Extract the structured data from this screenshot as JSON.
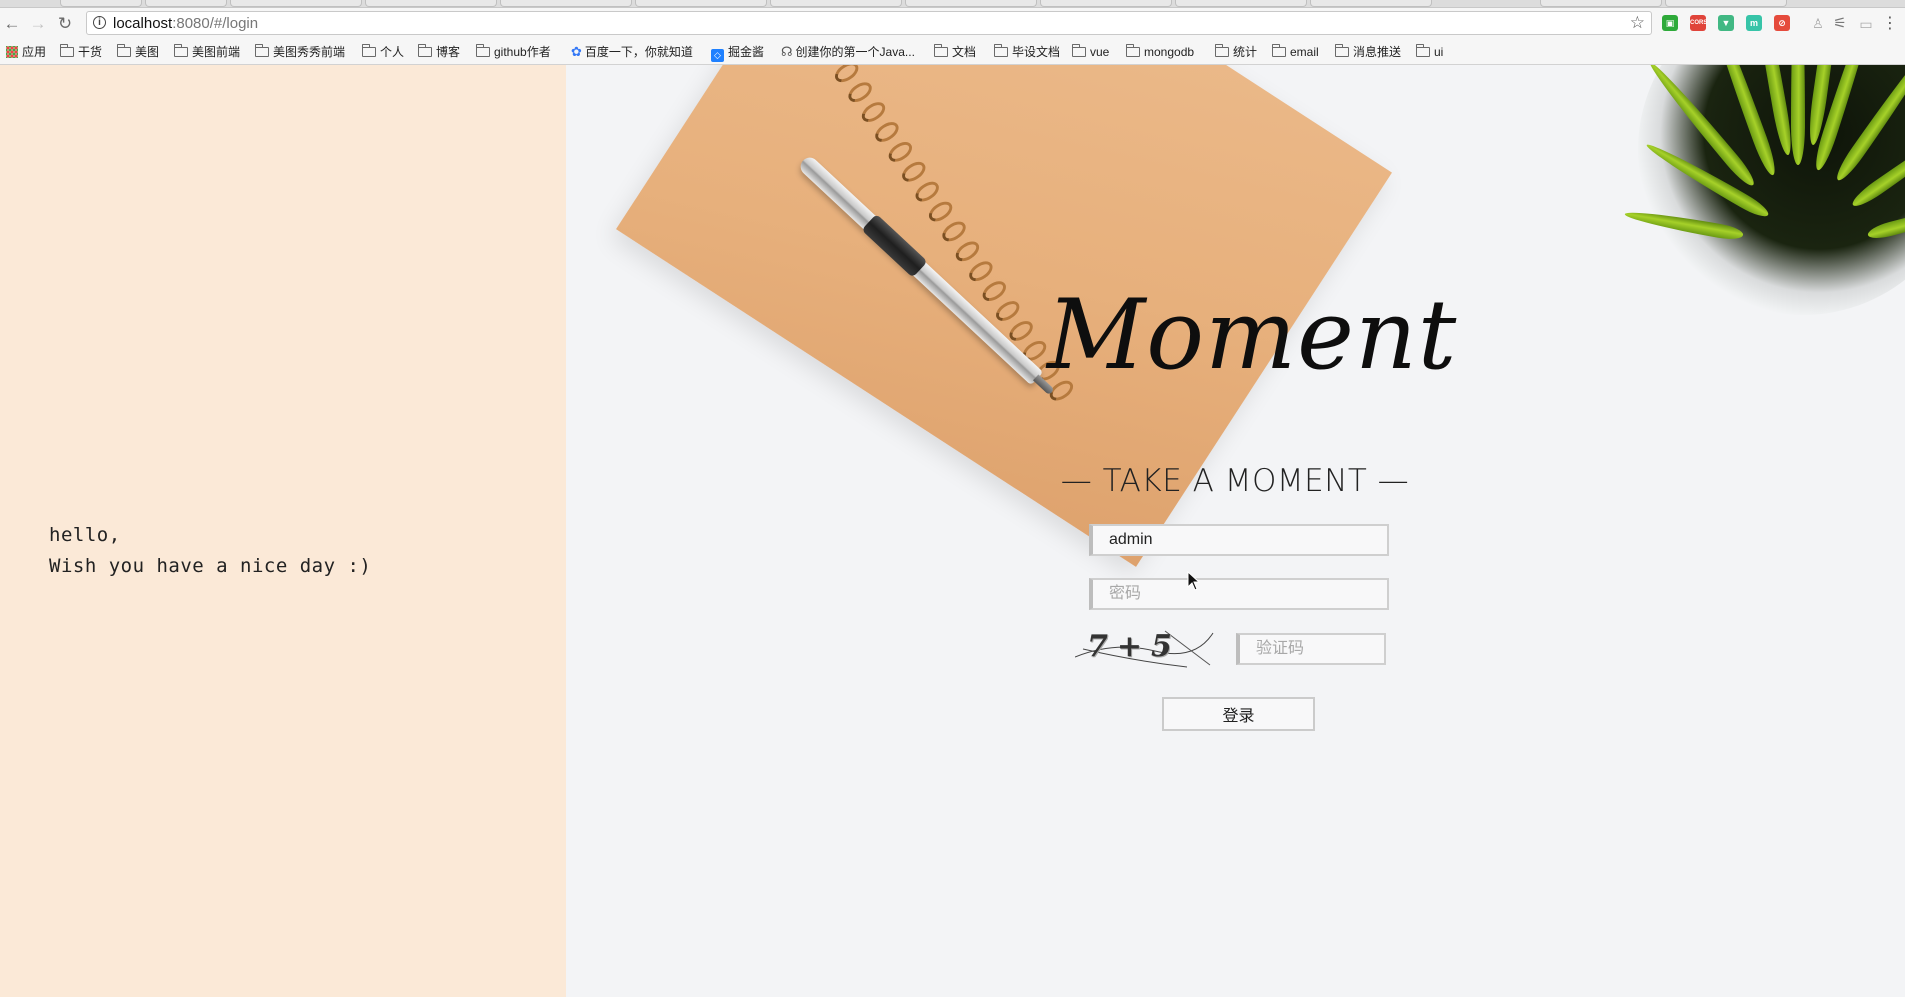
{
  "browser": {
    "url_host": "localhost",
    "url_rest": ":8080/#/login",
    "bookmarks": [
      {
        "icon": "apps-icon",
        "label": "应用"
      },
      {
        "icon": "folder-icon",
        "label": "干货"
      },
      {
        "icon": "folder-icon",
        "label": "美图"
      },
      {
        "icon": "folder-icon",
        "label": "美图前端"
      },
      {
        "icon": "folder-icon",
        "label": "美图秀秀前端"
      },
      {
        "icon": "folder-icon",
        "label": "个人"
      },
      {
        "icon": "folder-icon",
        "label": "博客"
      },
      {
        "icon": "folder-icon",
        "label": "github作者"
      },
      {
        "icon": "paw-icon",
        "label": "百度一下，你就知道"
      },
      {
        "icon": "juejin-icon",
        "label": "掘金酱"
      },
      {
        "icon": "csdn-icon",
        "label": "创建你的第一个Java..."
      },
      {
        "icon": "folder-icon",
        "label": "文档"
      },
      {
        "icon": "folder-icon",
        "label": "毕设文档"
      },
      {
        "icon": "folder-icon",
        "label": "vue"
      },
      {
        "icon": "folder-icon",
        "label": "mongodb"
      },
      {
        "icon": "folder-icon",
        "label": "统计"
      },
      {
        "icon": "folder-icon",
        "label": "email"
      },
      {
        "icon": "folder-icon",
        "label": "消息推送"
      },
      {
        "icon": "folder-icon",
        "label": "ui"
      }
    ],
    "extensions": [
      {
        "name": "green-square-extension-icon",
        "color": "#2eaa3a",
        "glyph": "▣"
      },
      {
        "name": "cors-extension-icon",
        "color": "#e0443a",
        "glyph": "CORS"
      },
      {
        "name": "vue-devtools-icon",
        "color": "#41b883",
        "glyph": "▼"
      },
      {
        "name": "m-extension-icon",
        "color": "#37c4a8",
        "glyph": "m"
      },
      {
        "name": "red-circle-extension-icon",
        "color": "#e54b3c",
        "glyph": "⊘"
      }
    ]
  },
  "greeting": {
    "line1": "hello,",
    "line2": "Wish you have a nice day :)"
  },
  "login": {
    "logo": "Moment",
    "tagline": "— TAKE A MOMENT —",
    "username_value": "admin",
    "password_placeholder": "密码",
    "captcha_text": "7+5",
    "captcha_placeholder": "验证码",
    "submit_label": "登录"
  },
  "colors": {
    "left_panel_bg": "#fbe9d7",
    "right_panel_bg": "#f3f4f6",
    "input_border": "#cfcfcf"
  }
}
